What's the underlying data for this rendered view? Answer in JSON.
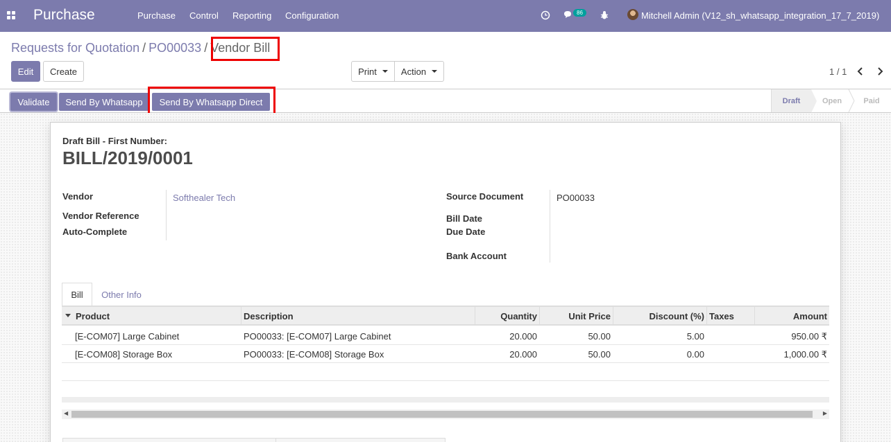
{
  "navbar": {
    "brand": "Purchase",
    "menu": [
      "Purchase",
      "Control",
      "Reporting",
      "Configuration"
    ],
    "message_count": "86",
    "user_name": "Mitchell Admin (V12_sh_whatsapp_integration_17_7_2019)",
    "icons": [
      "apps-icon",
      "clock-icon",
      "chat-icon",
      "bug-icon",
      "avatar"
    ]
  },
  "breadcrumb": {
    "items": [
      "Requests for Quotation",
      "PO00033"
    ],
    "current": "Vendor Bill",
    "separator": "/"
  },
  "toolbar": {
    "edit_label": "Edit",
    "create_label": "Create",
    "print_label": "Print",
    "action_label": "Action",
    "pager_value": "1 / 1"
  },
  "statusbar": {
    "buttons": [
      "Validate",
      "Send By Whatsapp",
      "Send By Whatsapp Direct"
    ],
    "stages": [
      "Draft",
      "Open",
      "Paid"
    ],
    "active_stage": "Draft"
  },
  "form": {
    "draft_label": "Draft Bill",
    "first_number_label": "- First Number:",
    "bill_number": "BILL/2019/0001",
    "left_fields": {
      "vendor_label": "Vendor",
      "vendor_value": "Softhealer Tech",
      "vendor_reference_label": "Vendor Reference",
      "auto_complete_label": "Auto-Complete"
    },
    "right_fields": {
      "source_document_label": "Source Document",
      "source_document_value": "PO00033",
      "bill_date_label": "Bill Date",
      "due_date_label": "Due Date",
      "bank_account_label": "Bank Account"
    },
    "tabs": [
      "Bill",
      "Other Info"
    ],
    "active_tab": "Bill",
    "table": {
      "columns": [
        "Product",
        "Description",
        "Quantity",
        "Unit Price",
        "Discount (%)",
        "Taxes",
        "Amount"
      ],
      "rows": [
        {
          "product": "[E-COM07] Large Cabinet",
          "description": "PO00033: [E-COM07] Large Cabinet",
          "quantity": "20.000",
          "unit_price": "50.00",
          "discount": "5.00",
          "taxes": "",
          "amount": "950.00 ₹"
        },
        {
          "product": "[E-COM08] Storage Box",
          "description": "PO00033: [E-COM08] Storage Box",
          "quantity": "20.000",
          "unit_price": "50.00",
          "discount": "0.00",
          "taxes": "",
          "amount": "1,000.00 ₹"
        }
      ]
    }
  },
  "colors": {
    "brand": "#7c7bad",
    "highlight": "#ee0000"
  }
}
